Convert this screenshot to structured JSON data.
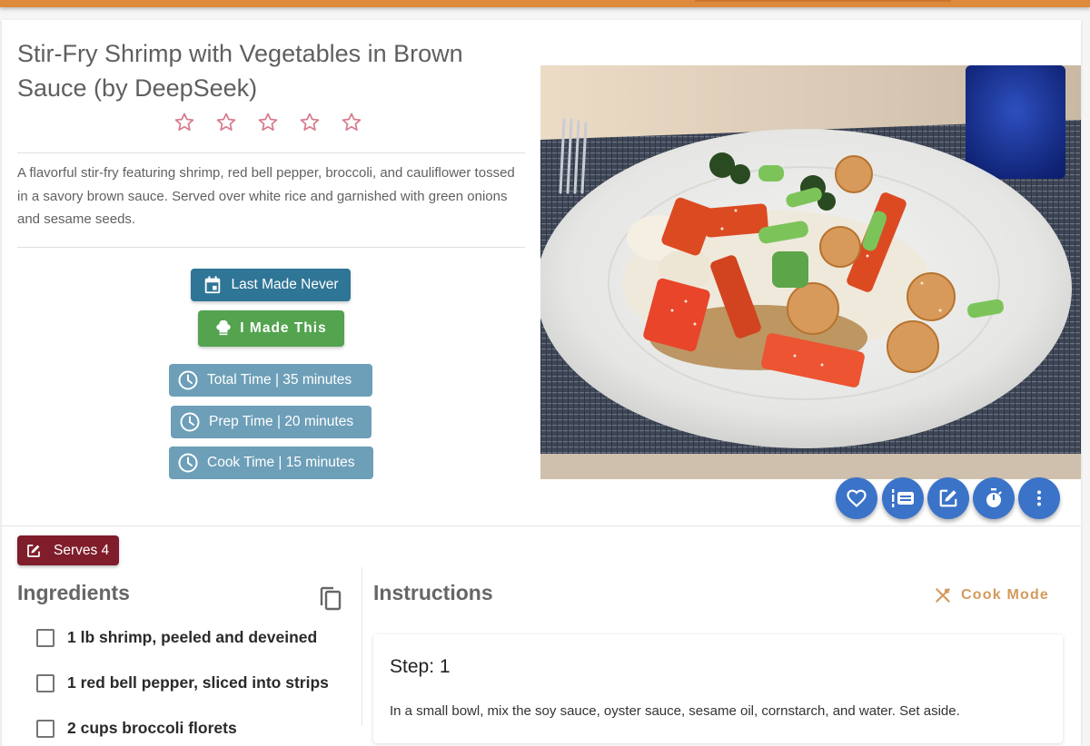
{
  "app": {
    "accent_color": "#dd8a3c"
  },
  "recipe": {
    "title": "Stir-Fry Shrimp with Vegetables in Brown Sauce (by DeepSeek)",
    "rating": {
      "value": 0,
      "max": 5,
      "star_color": "#d87a8c"
    },
    "description": "A flavorful stir-fry featuring shrimp, red bell pepper, broccoli, and cauliflower tossed in a savory brown sauce. Served over white rice and garnished with green onions and sesame seeds.",
    "image_alt": "Plate of stir-fry shrimp with red bell pepper, broccoli, green onions and sesame seeds over white rice"
  },
  "buttons": {
    "last_made": {
      "label": "Last Made Never",
      "icon": "calendar-icon",
      "color": "#2f7596"
    },
    "made_this": {
      "label": "I Made This",
      "icon": "chef-hat-icon",
      "color": "#53a34f"
    }
  },
  "times": [
    {
      "label": "Total Time | 35 minutes",
      "icon": "clock-icon"
    },
    {
      "label": "Prep Time | 20 minutes",
      "icon": "clock-icon"
    },
    {
      "label": "Cook Time | 15 minutes",
      "icon": "clock-icon"
    }
  ],
  "actions": [
    {
      "name": "favorite",
      "icon": "heart-icon"
    },
    {
      "name": "add-to-list",
      "icon": "list-icon"
    },
    {
      "name": "edit",
      "icon": "edit-icon"
    },
    {
      "name": "timer",
      "icon": "timer-icon"
    },
    {
      "name": "more",
      "icon": "more-vert-icon"
    }
  ],
  "servings": {
    "label": "Serves 4",
    "icon": "edit-icon",
    "color": "#7f1d2b"
  },
  "ingredients": {
    "title": "Ingredients",
    "copy_icon": "copy-icon",
    "items": [
      {
        "text": "1 lb shrimp, peeled and deveined",
        "checked": false
      },
      {
        "text": "1 red bell pepper, sliced into strips",
        "checked": false
      },
      {
        "text": "2 cups broccoli florets",
        "checked": false
      }
    ]
  },
  "instructions": {
    "title": "Instructions",
    "cook_mode_label": "Cook Mode",
    "cook_mode_icon": "utensils-icon",
    "steps": [
      {
        "title": "Step: 1",
        "text": "In a small bowl, mix the soy sauce, oyster sauce, sesame oil, cornstarch, and water. Set aside."
      }
    ]
  }
}
